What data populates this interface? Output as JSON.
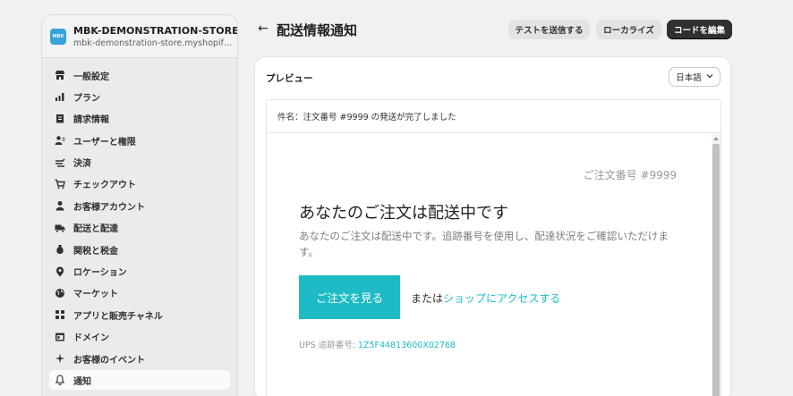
{
  "store": {
    "logo_text": "MBK",
    "name": "MBK-DEMONSTRATION-STORE",
    "url": "mbk-demonstration-store.myshopify.c..."
  },
  "sidebar": {
    "items": [
      {
        "label": "一般設定",
        "icon": "store-icon"
      },
      {
        "label": "プラン",
        "icon": "plan-chart-icon"
      },
      {
        "label": "請求情報",
        "icon": "receipt-icon"
      },
      {
        "label": "ユーザーと権限",
        "icon": "users-icon"
      },
      {
        "label": "決済",
        "icon": "payments-icon"
      },
      {
        "label": "チェックアウト",
        "icon": "cart-icon"
      },
      {
        "label": "お客様アカウント",
        "icon": "person-icon"
      },
      {
        "label": "配送と配達",
        "icon": "truck-icon"
      },
      {
        "label": "関税と税金",
        "icon": "tax-bag-icon"
      },
      {
        "label": "ロケーション",
        "icon": "location-pin-icon"
      },
      {
        "label": "マーケット",
        "icon": "globe-icon"
      },
      {
        "label": "アプリと販売チャネル",
        "icon": "apps-icon"
      },
      {
        "label": "ドメイン",
        "icon": "domain-icon"
      },
      {
        "label": "お客様のイベント",
        "icon": "sparkle-icon"
      },
      {
        "label": "通知",
        "icon": "bell-icon",
        "active": true
      }
    ]
  },
  "header": {
    "back_glyph": "←",
    "title": "配送情報通知",
    "send_test_label": "テストを送信する",
    "localize_label": "ローカライズ",
    "edit_code_label": "コードを編集"
  },
  "preview": {
    "title": "プレビュー",
    "language": "日本語",
    "subject": "件名：注文番号 #9999 の発送が完了しました",
    "order_number": "ご注文番号 #9999",
    "heading": "あなたのご注文は配送中です",
    "body": "あなたのご注文は配送中です。追跡番号を使用し、配達状況をご確認いただけます。",
    "view_order_label": "ご注文を見る",
    "or_text": "または",
    "shop_link": "ショップにアクセスする",
    "tracking_label": "UPS 追跡番号: ",
    "tracking_number": "1Z5F44813600X02768"
  },
  "colors": {
    "accent": "#1ebbc6",
    "primary_button": "#303030",
    "background": "#f1f1f1"
  }
}
